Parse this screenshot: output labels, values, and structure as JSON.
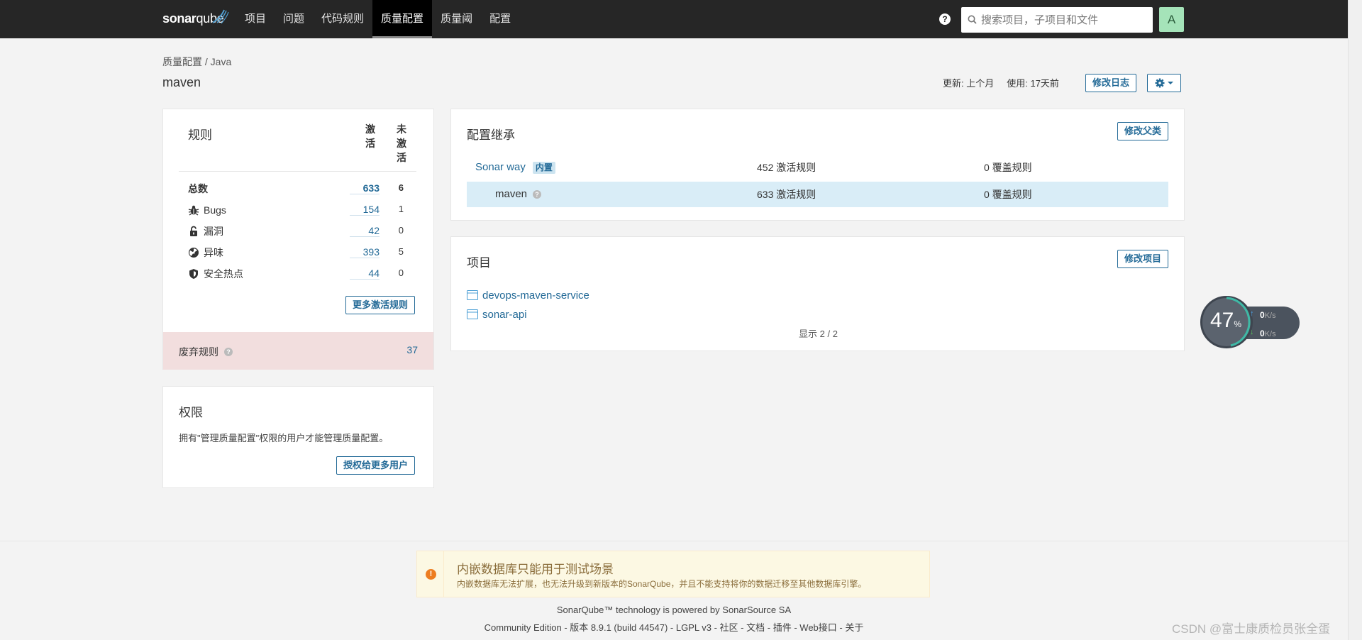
{
  "nav": {
    "logo_bold": "sonar",
    "logo_thin": "qube",
    "items": [
      {
        "label": "项目"
      },
      {
        "label": "问题"
      },
      {
        "label": "代码规则"
      },
      {
        "label": "质量配置"
      },
      {
        "label": "质量阈"
      },
      {
        "label": "配置"
      }
    ],
    "active_index": 3,
    "help_symbol": "?",
    "search_placeholder": "搜索项目，子项目和文件",
    "avatar_letter": "A"
  },
  "header": {
    "breadcrumb_root": "质量配置",
    "breadcrumb_sep": " / ",
    "breadcrumb_lang": "Java",
    "title": "maven",
    "updated": "更新: 上个月",
    "used": "使用: 17天前",
    "changelog_button": "修改日志"
  },
  "rules": {
    "title": "规则",
    "col_active": "激活",
    "col_inactive": "未激活",
    "rows": [
      {
        "label": "总数",
        "icon": "",
        "active": "633",
        "inactive": "6"
      },
      {
        "label": "Bugs",
        "icon": "bug-icon",
        "active": "154",
        "inactive": "1"
      },
      {
        "label": "漏洞",
        "icon": "lock-icon",
        "active": "42",
        "inactive": "0"
      },
      {
        "label": "异味",
        "icon": "code-smell-icon",
        "active": "393",
        "inactive": "5"
      },
      {
        "label": "安全热点",
        "icon": "shield-icon",
        "active": "44",
        "inactive": "0"
      }
    ],
    "more_button": "更多激活规则",
    "deprecated_label": "废弃规则",
    "deprecated_count": "37"
  },
  "permissions": {
    "title": "权限",
    "text": "拥有\"管理质量配置\"权限的用户才能管理质量配置。",
    "grant_button": "授权给更多用户"
  },
  "inheritance": {
    "title": "配置继承",
    "change_parent_button": "修改父类",
    "rows": [
      {
        "name": "Sonar way",
        "badge": "内置",
        "active_rules": "452 激活规则",
        "overridden": "0 覆盖规则"
      },
      {
        "name": "maven",
        "badge": "",
        "active_rules": "633 激活规则",
        "overridden": "0 覆盖规则"
      }
    ]
  },
  "projects": {
    "title": "项目",
    "edit_button": "修改项目",
    "items": [
      {
        "name": "devops-maven-service"
      },
      {
        "name": "sonar-api"
      }
    ],
    "count_text": "显示 2 / 2"
  },
  "widget": {
    "percent": "47",
    "percent_unit": "%",
    "up_value": "0",
    "down_value": "0",
    "speed_unit": "K/s"
  },
  "footer": {
    "alert_title": "内嵌数据库只能用于测试场景",
    "alert_text": "内嵌数据库无法扩展，也无法升级到新版本的SonarQube，并且不能支持将你的数据迁移至其他数据库引擎。",
    "powered_prefix": "SonarQube™ technology is powered by ",
    "powered_link": "SonarSource SA",
    "edition": "Community Edition - 版本 8.9.1 (build 44547) - ",
    "links": [
      "LGPL v3",
      "社区",
      "文档",
      "插件",
      "Web接口",
      "关于"
    ],
    "watermark": "CSDN @富士康质检员张全蛋"
  },
  "colors": {
    "nav_bg": "#262626",
    "link": "#236a97",
    "selected_row": "#d9edf7",
    "deprecated_bg": "#f2dede",
    "alert_bg": "#fcf8e3",
    "avatar_bg": "#a5e3b9"
  }
}
